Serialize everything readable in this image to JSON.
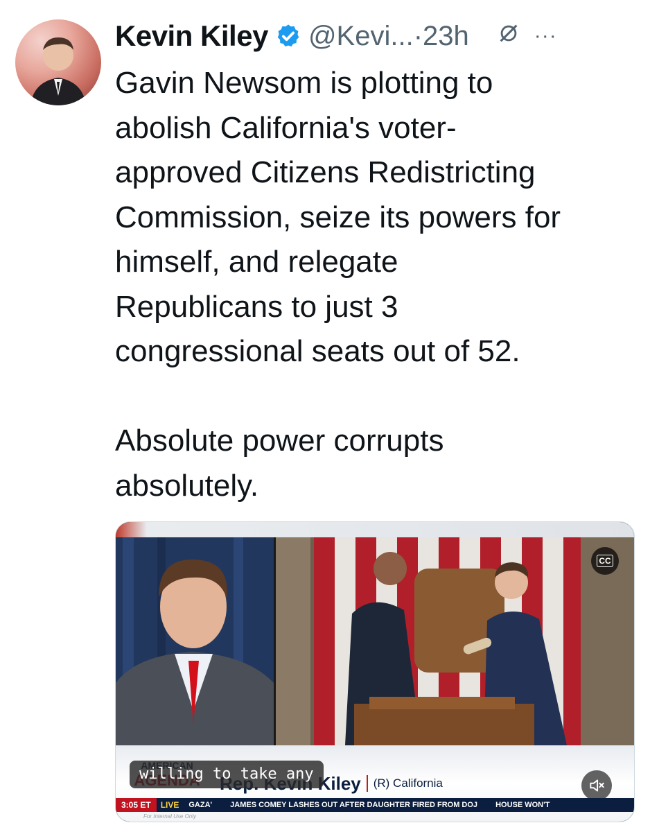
{
  "tweet": {
    "author_name": "Kevin Kiley",
    "handle": "@Kevi...",
    "separator": "·",
    "time": "23h",
    "more_icon": "···",
    "text": "Gavin Newsom is plotting to\nabolish California's voter-\napproved Citizens Redistricting\nCommission, seize its powers for\nhimself, and relegate\nRepublicans to just 3\ncongressional seats out of 52.\n\nAbsolute power corrupts\nabsolutely."
  },
  "video": {
    "caption": "willing to take any",
    "show_logo": "AMERICAN AGENDA",
    "lower_third_name": "Rep. Kevin Kiley",
    "lower_third_party": "(R) California",
    "cc_label": "CC",
    "ticker": {
      "time": "3:05 ET",
      "live": "LIVE",
      "items": [
        "GAZA'",
        "JAMES COMEY LASHES OUT AFTER DAUGHTER FIRED FROM DOJ",
        "HOUSE WON'T"
      ]
    },
    "footnote": "For Internal Use Only"
  },
  "colors": {
    "verified_blue": "#1d9bf0",
    "text_primary": "#0f1419",
    "text_secondary": "#536471",
    "ticker_red": "#c1121f",
    "ticker_navy": "#0b1e3f"
  },
  "icons": {
    "verified": "verified-badge-icon",
    "grok": "grok-icon",
    "more": "more-options-icon",
    "cc": "closed-captions-icon",
    "mute": "muted-speaker-icon"
  }
}
